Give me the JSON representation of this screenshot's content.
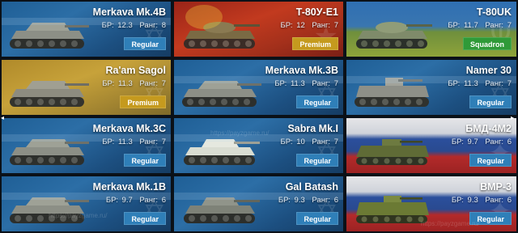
{
  "cards": [
    {
      "name": "Merkava Mk.4B",
      "br_label": "БР:",
      "br": "12.3",
      "rank_label": "Ранг:",
      "rank": "8",
      "button": "Regular",
      "button_type": "regular",
      "background": "israel",
      "tank_icon": "tank-icon"
    },
    {
      "name": "T-80У-E1",
      "br_label": "БР:",
      "br": "12",
      "rank_label": "Ранг:",
      "rank": "7",
      "button": "Premium",
      "button_type": "premium",
      "background": "ussr",
      "tank_icon": "tank-icon"
    },
    {
      "name": "T-80UK",
      "br_label": "БР:",
      "br": "11.7",
      "rank_label": "Ранг:",
      "rank": "7",
      "button": "Squadron",
      "button_type": "squadron",
      "background": "ukr",
      "tank_icon": "tank-icon"
    },
    {
      "name": "Ra'am Sagol",
      "br_label": "БР:",
      "br": "11.3",
      "rank_label": "Ранг:",
      "rank": "7",
      "button": "Premium",
      "button_type": "premium",
      "background": "gold",
      "tank_icon": "tank-icon"
    },
    {
      "name": "Merkava Mk.3B",
      "br_label": "БР:",
      "br": "11.3",
      "rank_label": "Ранг:",
      "rank": "7",
      "button": "Regular",
      "button_type": "regular",
      "background": "israel",
      "tank_icon": "tank-icon"
    },
    {
      "name": "Namer 30",
      "br_label": "БР:",
      "br": "11.3",
      "rank_label": "Ранг:",
      "rank": "7",
      "button": "Regular",
      "button_type": "regular",
      "background": "israel",
      "tank_icon": "tank-icon"
    },
    {
      "name": "Merkava Mk.3C",
      "br_label": "БР:",
      "br": "11.3",
      "rank_label": "Ранг:",
      "rank": "7",
      "button": "Regular",
      "button_type": "regular",
      "background": "israel",
      "tank_icon": "tank-icon"
    },
    {
      "name": "Sabra Mk.I",
      "br_label": "БР:",
      "br": "10",
      "rank_label": "Ранг:",
      "rank": "7",
      "button": "Regular",
      "button_type": "regular",
      "background": "israel",
      "tank_icon": "tank-icon"
    },
    {
      "name": "БМД-4М2",
      "br_label": "БР:",
      "br": "9.7",
      "rank_label": "Ранг:",
      "rank": "6",
      "button": "Regular",
      "button_type": "regular",
      "background": "russia",
      "tank_icon": "ifv-icon"
    },
    {
      "name": "Merkava Mk.1B",
      "br_label": "БР:",
      "br": "9.7",
      "rank_label": "Ранг:",
      "rank": "6",
      "button": "Regular",
      "button_type": "regular",
      "background": "israel",
      "tank_icon": "tank-icon"
    },
    {
      "name": "Gal Batash",
      "br_label": "БР:",
      "br": "9.3",
      "rank_label": "Ранг:",
      "rank": "6",
      "button": "Regular",
      "button_type": "regular",
      "background": "israel",
      "tank_icon": "tank-icon"
    },
    {
      "name": "BMP-3",
      "br_label": "БР:",
      "br": "9.3",
      "rank_label": "Ранг:",
      "rank": "6",
      "button": "Regular",
      "button_type": "regular",
      "background": "russia",
      "tank_icon": "ifv-icon"
    }
  ],
  "watermark": "https://payzgame.ru/",
  "colors": {
    "regular": "#2f7fb8",
    "premium": "#c59a1e",
    "squadron": "#2f9a38"
  }
}
